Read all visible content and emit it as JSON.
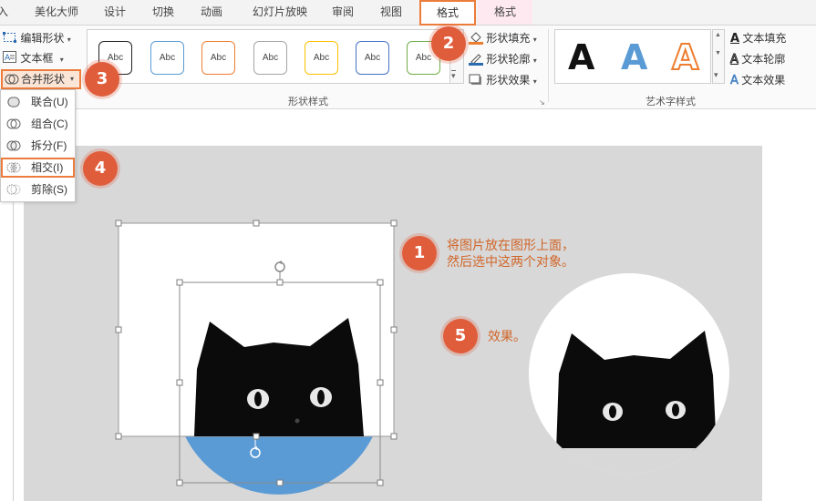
{
  "tabs": [
    {
      "label": "入",
      "x": -4
    },
    {
      "label": "美化大师"
    },
    {
      "label": "设计"
    },
    {
      "label": "切换"
    },
    {
      "label": "动画"
    },
    {
      "label": "幻灯片放映"
    },
    {
      "label": "审阅"
    },
    {
      "label": "视图"
    },
    {
      "label": "格式"
    },
    {
      "label": "格式"
    }
  ],
  "ribbon": {
    "edit_shape": "编辑形状",
    "text_box": "文本框",
    "merge_shapes": "合并形状",
    "shape_style_thumb": "Abc",
    "shape_fill": "形状填充",
    "shape_outline": "形状轮廓",
    "shape_effect": "形状效果",
    "shape_styles_group": "形状样式",
    "wordart_letter": "A",
    "text_fill": "文本填充",
    "text_outline": "文本轮廓",
    "text_effect": "文本效果",
    "wordart_group": "艺术字样式"
  },
  "menu": {
    "items": [
      {
        "label": "联合(U)"
      },
      {
        "label": "组合(C)"
      },
      {
        "label": "拆分(F)"
      },
      {
        "label": "相交(I)"
      },
      {
        "label": "剪除(S)"
      }
    ]
  },
  "callouts": {
    "step1_num": "1",
    "step1_line1": "将图片放在图形上面，",
    "step1_line2": "然后选中这两个对象。",
    "step2_num": "2",
    "step3_num": "3",
    "step4_num": "4",
    "step5_num": "5",
    "step5_text": "效果。"
  },
  "colors": {
    "accent_orange": "#ec7c3b",
    "badge": "#e05d3c",
    "callout_text": "#d0662a",
    "shape_blue": "#5b9bd5"
  }
}
